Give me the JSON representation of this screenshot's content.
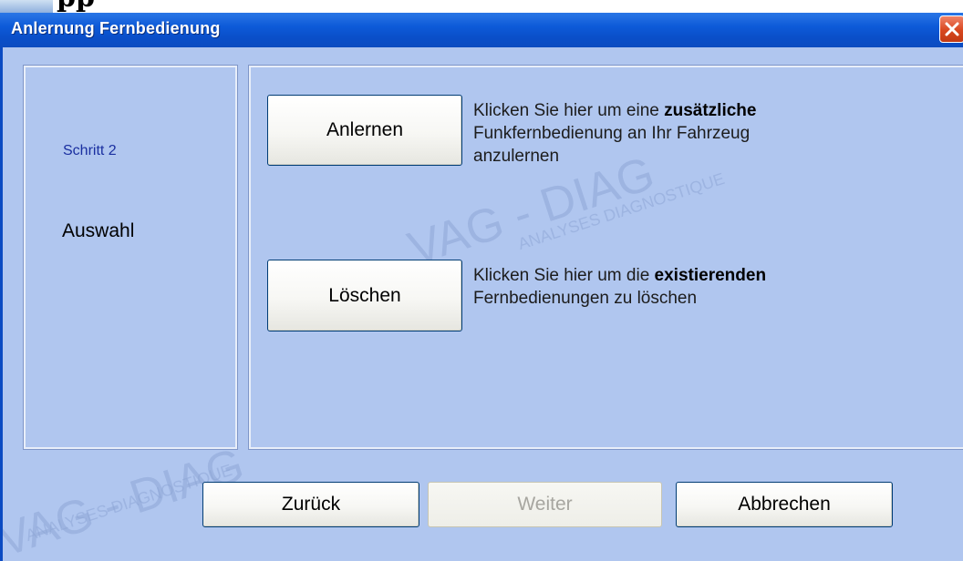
{
  "window": {
    "title": "Anlernung Fernbedienung"
  },
  "doc_fragment": "pp",
  "watermark": {
    "line1": "VAG - DIAG",
    "line2": "ANALYSES DIAGNOSTIQUE"
  },
  "sidebar": {
    "step": "Schritt 2",
    "mode": "Auswahl"
  },
  "options": [
    {
      "button": "Anlernen",
      "line1_prefix": "Klicken Sie hier um eine ",
      "line1_bold": "zusätzliche",
      "line2": "Funkfernbedienung an Ihr Fahrzeug",
      "line3": "anzulernen"
    },
    {
      "button": "Löschen",
      "line1_prefix": "Klicken Sie hier um die ",
      "line1_bold": "existierenden",
      "line2": "Fernbedienungen zu löschen"
    }
  ],
  "footer": {
    "back": "Zurück",
    "next": "Weiter",
    "cancel": "Abbrechen"
  },
  "colors": {
    "titlebar": "#0d5ad8",
    "client_bg": "#b0c6ef",
    "step_text": "#1a2fa0",
    "close_button": "#d8471f"
  },
  "icons": {
    "close": "close-icon"
  },
  "state": {
    "next_enabled": false
  }
}
